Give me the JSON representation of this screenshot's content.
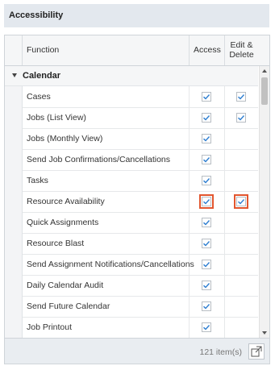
{
  "panel": {
    "title": "Accessibility"
  },
  "columns": {
    "function": "Function",
    "access": "Access",
    "edit_delete_line1": "Edit &",
    "edit_delete_line2": "Delete"
  },
  "group": {
    "label": "Calendar",
    "expanded": true
  },
  "rows": [
    {
      "function": "Cases",
      "access": true,
      "edit_delete": true
    },
    {
      "function": "Jobs (List View)",
      "access": true,
      "edit_delete": true
    },
    {
      "function": "Jobs (Monthly View)",
      "access": true,
      "edit_delete": false
    },
    {
      "function": "Send Job Confirmations/Cancellations",
      "access": true,
      "edit_delete": false
    },
    {
      "function": "Tasks",
      "access": true,
      "edit_delete": false
    },
    {
      "function": "Resource Availability",
      "access": true,
      "edit_delete": true,
      "highlighted": true
    },
    {
      "function": "Quick Assignments",
      "access": true,
      "edit_delete": false
    },
    {
      "function": "Resource Blast",
      "access": true,
      "edit_delete": false
    },
    {
      "function": "Send Assignment Notifications/Cancellations",
      "access": true,
      "edit_delete": false
    },
    {
      "function": "Daily Calendar Audit",
      "access": true,
      "edit_delete": false
    },
    {
      "function": "Send Future Calendar",
      "access": true,
      "edit_delete": false
    },
    {
      "function": "Job Printout",
      "access": true,
      "edit_delete": false
    }
  ],
  "footer": {
    "item_count": "121 item(s)"
  },
  "colors": {
    "highlight": "#e2562f",
    "check": "#2f7fd1",
    "header_bg": "#e3e8ee"
  },
  "icons": {
    "expand": "triangle-down-icon",
    "popout": "popout-window-icon"
  }
}
